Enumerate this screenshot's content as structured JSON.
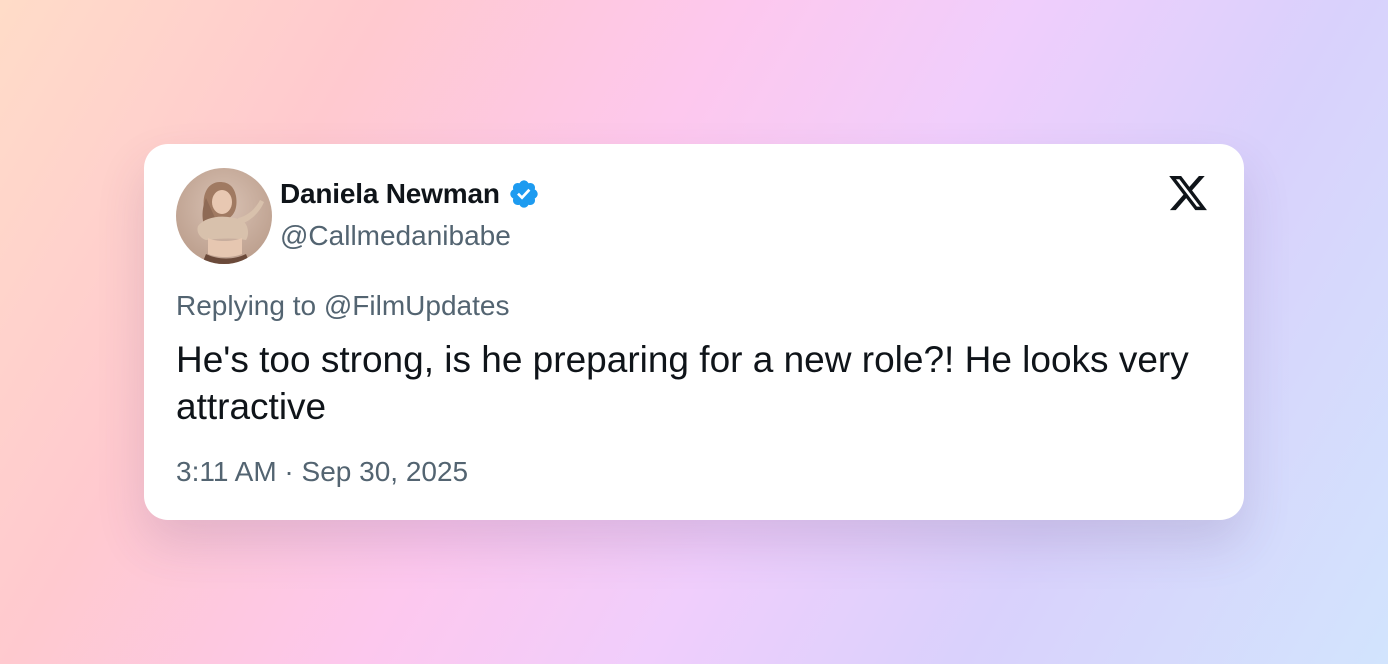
{
  "tweet": {
    "author": {
      "display_name": "Daniela Newman",
      "handle": "@Callmedanibabe",
      "verified": true,
      "verified_icon": "verified-badge-icon",
      "verified_color": "#1d9bf0"
    },
    "reply_context": "Replying to @FilmUpdates",
    "text": "He's too strong, is he preparing for a new role?! He looks very attractive",
    "timestamp": "3:11 AM · Sep 30, 2025"
  },
  "brand": {
    "logo_icon": "x-logo-icon"
  },
  "colors": {
    "primary_text": "#0f1419",
    "secondary_text": "#536471",
    "card_background": "#ffffff"
  }
}
